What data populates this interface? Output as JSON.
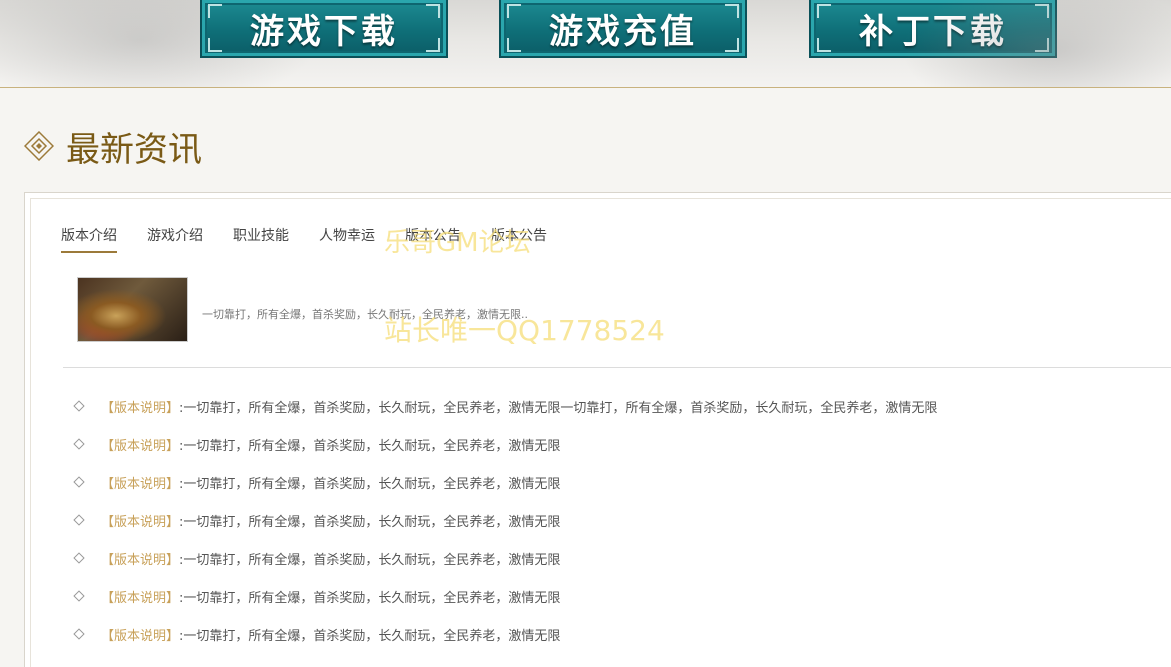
{
  "nav": {
    "buttons": [
      {
        "label": "游戏下载"
      },
      {
        "label": "游戏充值"
      },
      {
        "label": "补丁下载"
      }
    ]
  },
  "section": {
    "title": "最新资讯",
    "icon": "diamond-ornament-icon"
  },
  "tabs": [
    {
      "label": "版本介绍",
      "active": true
    },
    {
      "label": "游戏介绍"
    },
    {
      "label": "职业技能"
    },
    {
      "label": "人物幸运"
    },
    {
      "label": "版本公告"
    },
    {
      "label": "版本公告"
    }
  ],
  "feature": {
    "text": "一切靠打，所有全爆，首杀奖励，长久耐玩，全民养老，激情无限.."
  },
  "news": [
    {
      "tag": "【版本说明】",
      "text": ":一切靠打，所有全爆，首杀奖励，长久耐玩，全民养老，激情无限一切靠打，所有全爆，首杀奖励，长久耐玩，全民养老，激情无限"
    },
    {
      "tag": "【版本说明】",
      "text": ":一切靠打，所有全爆，首杀奖励，长久耐玩，全民养老，激情无限"
    },
    {
      "tag": "【版本说明】",
      "text": ":一切靠打，所有全爆，首杀奖励，长久耐玩，全民养老，激情无限"
    },
    {
      "tag": "【版本说明】",
      "text": ":一切靠打，所有全爆，首杀奖励，长久耐玩，全民养老，激情无限"
    },
    {
      "tag": "【版本说明】",
      "text": ":一切靠打，所有全爆，首杀奖励，长久耐玩，全民养老，激情无限"
    },
    {
      "tag": "【版本说明】",
      "text": ":一切靠打，所有全爆，首杀奖励，长久耐玩，全民养老，激情无限"
    },
    {
      "tag": "【版本说明】",
      "text": ":一切靠打，所有全爆，首杀奖励，长久耐玩，全民养老，激情无限"
    }
  ],
  "watermarks": {
    "forum": "乐哥GM论坛",
    "qq": "站长唯一QQ1778524"
  },
  "colors": {
    "button_teal": "#0f6f78",
    "title_gold": "#7a5a16",
    "tag_gold": "#c8a15a",
    "watermark_yellow": "#f5de78"
  }
}
